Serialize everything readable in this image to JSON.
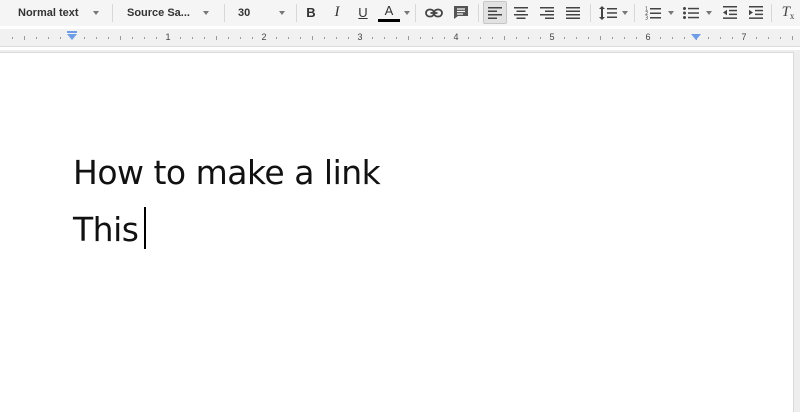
{
  "toolbar": {
    "style_dropdown": "Normal text",
    "font_dropdown": "Source Sa...",
    "size_dropdown": "30",
    "bold_label": "B",
    "italic_label": "I",
    "underline_label": "U",
    "text_color_label": "A",
    "text_color": "#000000",
    "icons": [
      "link-icon",
      "comment-icon",
      "align-left-icon",
      "align-center-icon",
      "align-right-icon",
      "align-justify-icon",
      "line-spacing-icon",
      "numbered-list-icon",
      "bulleted-list-icon",
      "decrease-indent-icon",
      "increase-indent-icon",
      "clear-formatting-icon"
    ],
    "clear_formatting_label": "T"
  },
  "ruler": {
    "numbers": [
      "1",
      "2",
      "3",
      "4",
      "5",
      "6",
      "7"
    ]
  },
  "document": {
    "line1": "How to make a link",
    "line2": "This"
  }
}
